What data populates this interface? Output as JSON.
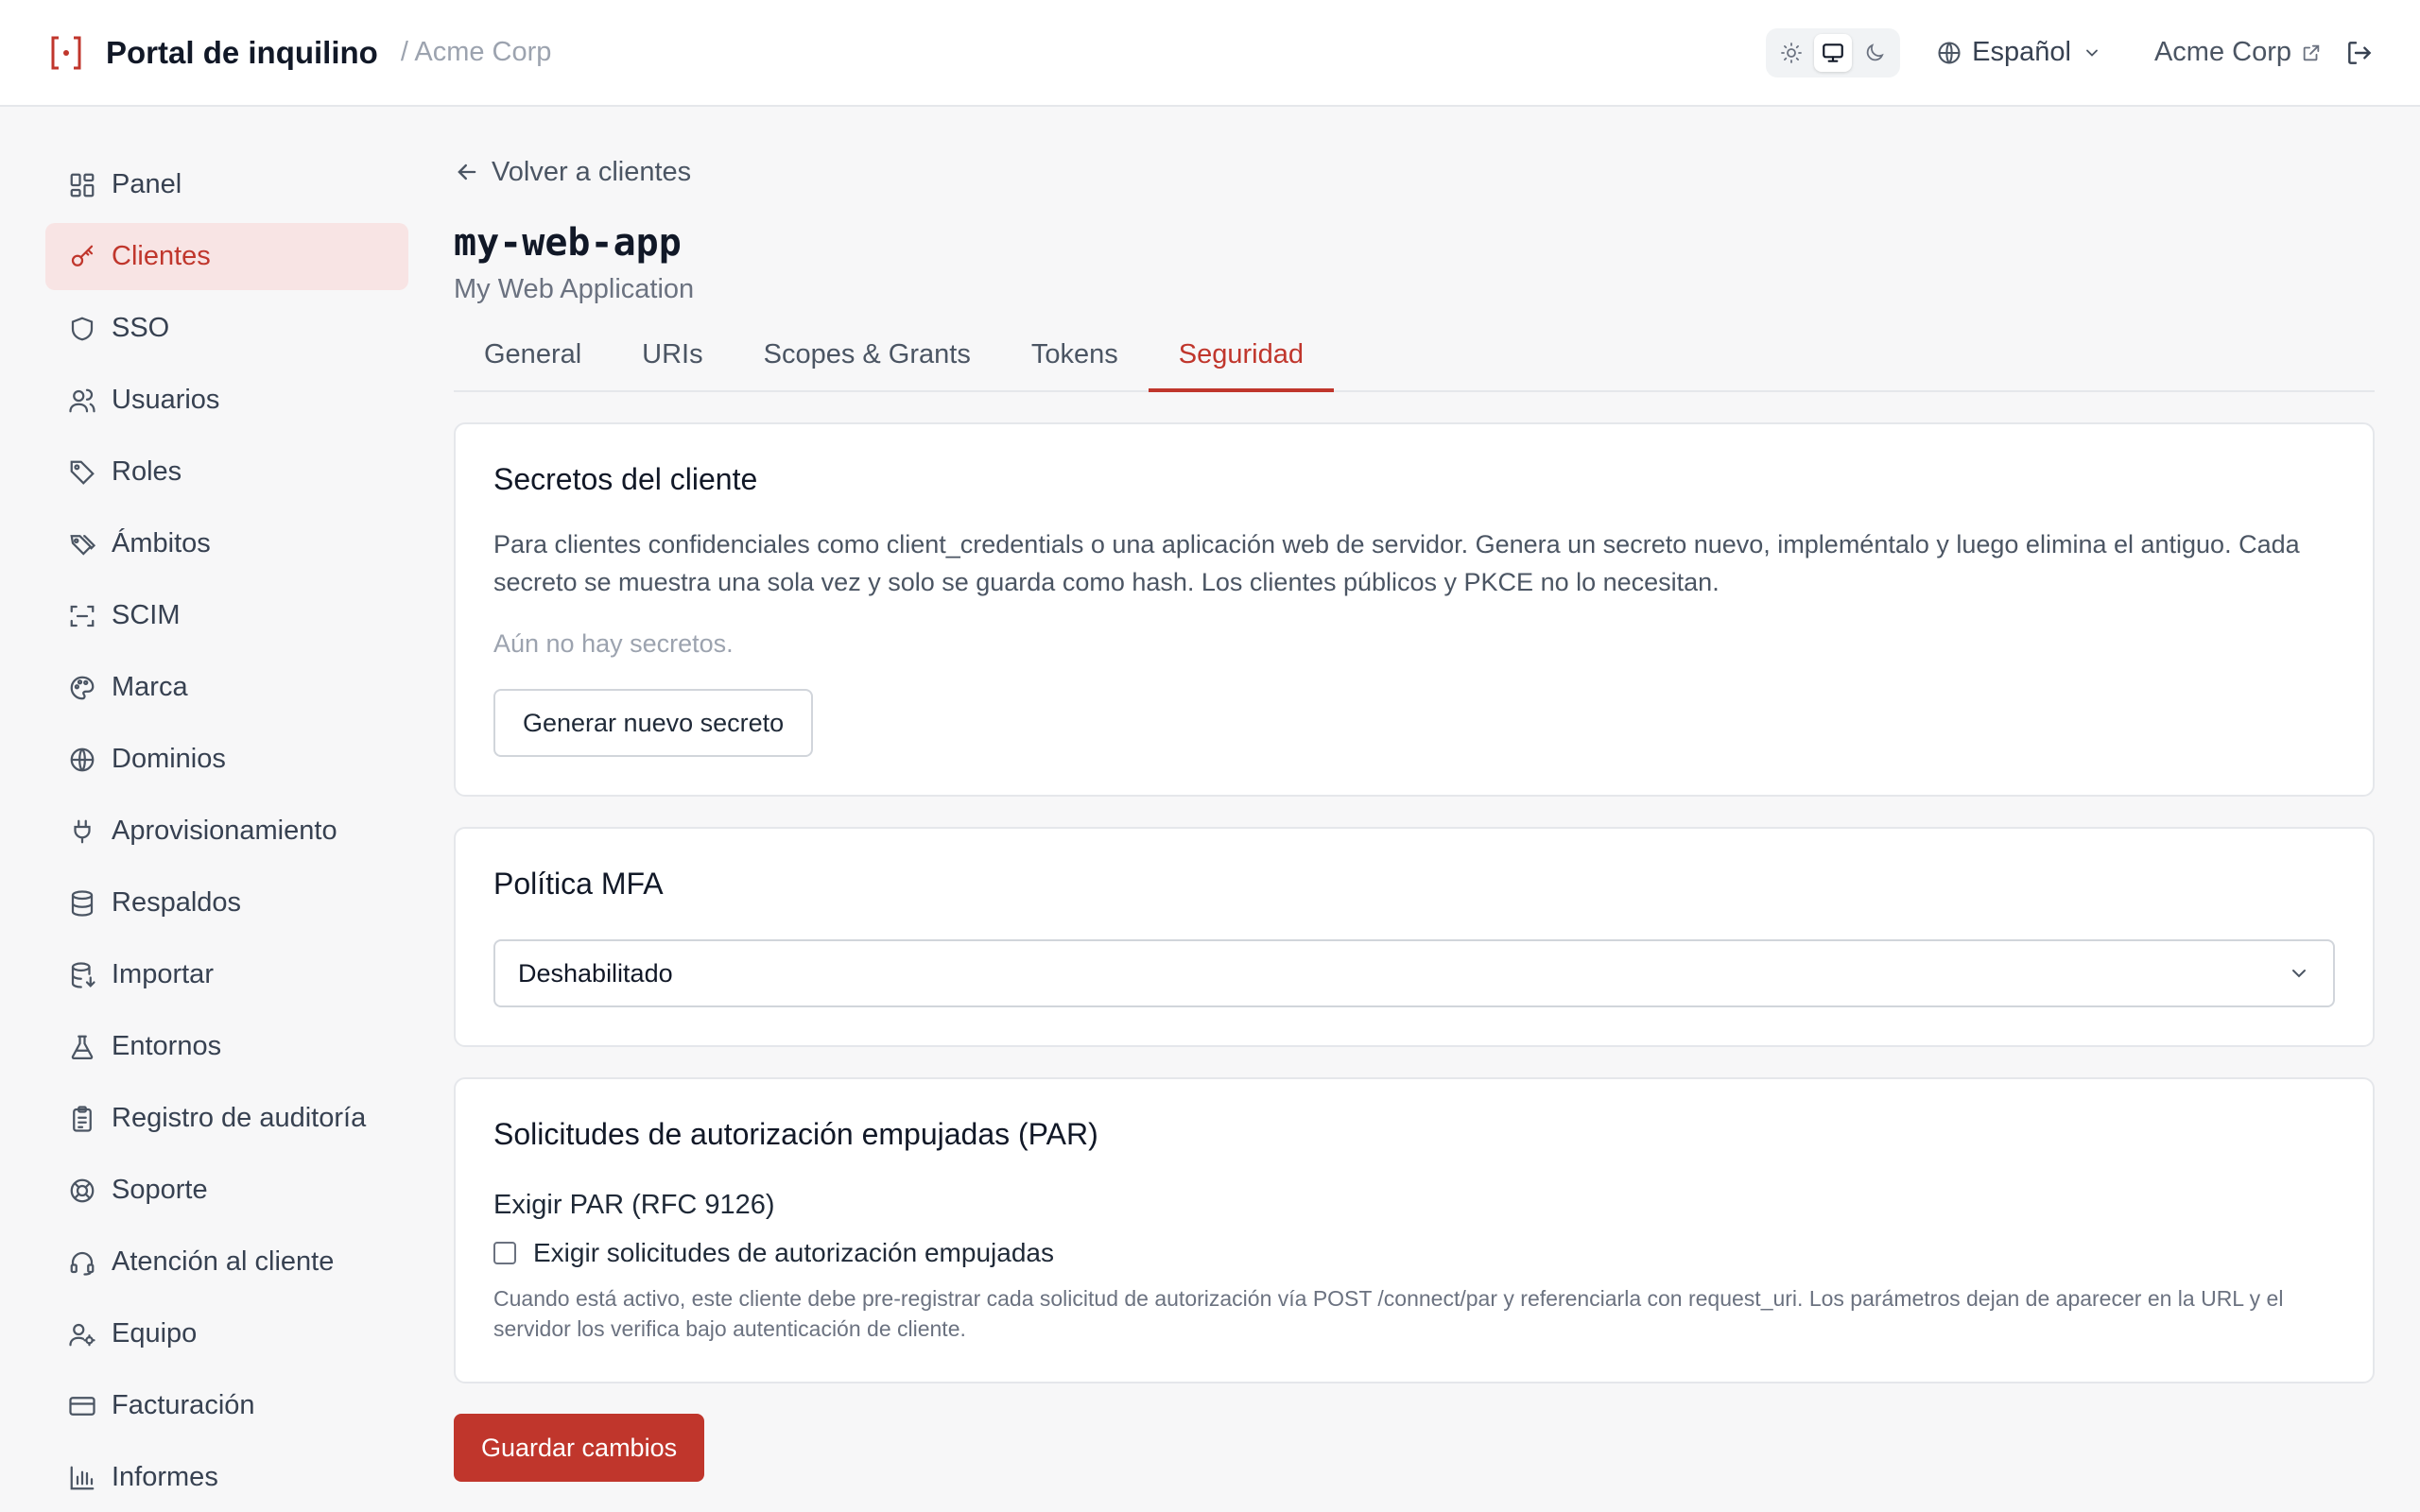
{
  "header": {
    "title": "Portal de inquilino",
    "breadcrumb_org": "/ Acme Corp",
    "language": "Español",
    "org_link": "Acme Corp",
    "theme_options": [
      "light-icon",
      "monitor-icon",
      "moon-icon"
    ],
    "theme_selected": "monitor-icon"
  },
  "colors": {
    "accent": "#c0362c",
    "active_nav_bg": "#f8e4e4"
  },
  "sidebar": {
    "items": [
      {
        "label": "Panel",
        "icon": "dashboard-icon"
      },
      {
        "label": "Clientes",
        "icon": "key-icon",
        "active": true
      },
      {
        "label": "SSO",
        "icon": "shield-icon"
      },
      {
        "label": "Usuarios",
        "icon": "users-icon"
      },
      {
        "label": "Roles",
        "icon": "tag-icon"
      },
      {
        "label": "Ámbitos",
        "icon": "tags-icon"
      },
      {
        "label": "SCIM",
        "icon": "scan-icon"
      },
      {
        "label": "Marca",
        "icon": "palette-icon"
      },
      {
        "label": "Dominios",
        "icon": "globe-icon"
      },
      {
        "label": "Aprovisionamiento",
        "icon": "plug-icon"
      },
      {
        "label": "Respaldos",
        "icon": "database-icon"
      },
      {
        "label": "Importar",
        "icon": "database-import-icon"
      },
      {
        "label": "Entornos",
        "icon": "flask-icon"
      },
      {
        "label": "Registro de auditoría",
        "icon": "clipboard-icon"
      },
      {
        "label": "Soporte",
        "icon": "lifebuoy-icon"
      },
      {
        "label": "Atención al cliente",
        "icon": "headset-icon"
      },
      {
        "label": "Equipo",
        "icon": "user-cog-icon"
      },
      {
        "label": "Facturación",
        "icon": "credit-card-icon"
      },
      {
        "label": "Informes",
        "icon": "bar-chart-icon"
      }
    ]
  },
  "main": {
    "back_label": "Volver a clientes",
    "client_id": "my-web-app",
    "client_name": "My Web Application",
    "tabs": [
      {
        "label": "General"
      },
      {
        "label": "URIs"
      },
      {
        "label": "Scopes & Grants"
      },
      {
        "label": "Tokens"
      },
      {
        "label": "Seguridad",
        "active": true
      }
    ],
    "secrets": {
      "title": "Secretos del cliente",
      "description": "Para clientes confidenciales como client_credentials o una aplicación web de servidor. Genera un secreto nuevo, impleméntalo y luego elimina el antiguo. Cada secreto se muestra una sola vez y solo se guarda como hash. Los clientes públicos y PKCE no lo necesitan.",
      "empty": "Aún no hay secretos.",
      "generate_label": "Generar nuevo secreto"
    },
    "mfa": {
      "title": "Política MFA",
      "selected": "Deshabilitado"
    },
    "par": {
      "title": "Solicitudes de autorización empujadas (PAR)",
      "field_label": "Exigir PAR (RFC 9126)",
      "checkbox_label": "Exigir solicitudes de autorización empujadas",
      "checked": false,
      "help": "Cuando está activo, este cliente debe pre-registrar cada solicitud de autorización vía POST /connect/par y referenciarla con request_uri. Los parámetros dejan de aparecer en la URL y el servidor los verifica bajo autenticación de cliente."
    },
    "save_label": "Guardar cambios"
  }
}
